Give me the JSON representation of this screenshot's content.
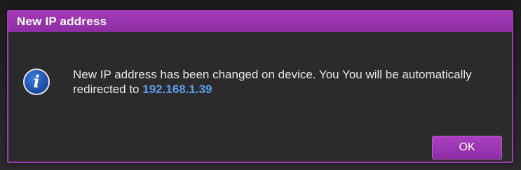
{
  "dialog": {
    "title": "New IP address",
    "icon": "info-icon",
    "icon_glyph": "i",
    "message_text": "New IP address has been changed on device. You You will be automatically redirected to ",
    "ip_address": "192.168.1.39",
    "ok_label": "OK"
  },
  "colors": {
    "accent": "#9e3fb0",
    "dialog_bg": "#2b2b2b",
    "link": "#5b9be8",
    "icon_blue": "#1f4fa8"
  }
}
